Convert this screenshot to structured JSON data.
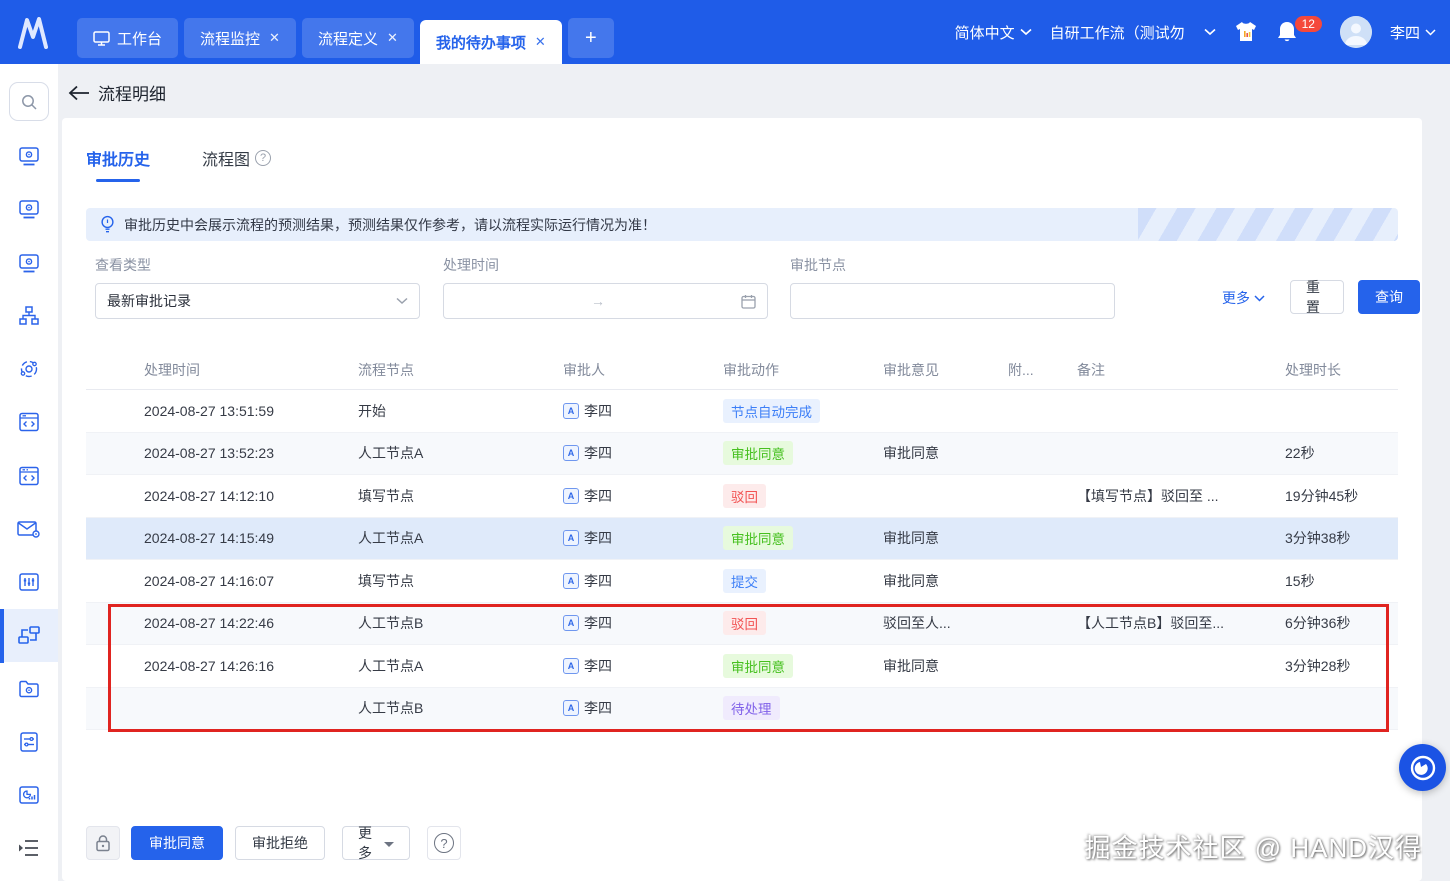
{
  "colors": {
    "navbar": "#1f5ce8",
    "accent": "#2563eb",
    "annotation_red": "#e02420",
    "tag_blue": "#3d7ff7",
    "tag_green": "#46c01f",
    "tag_red": "#f25353",
    "tag_purple": "#8162e9"
  },
  "navbar": {
    "tabs": [
      {
        "label": "工作台",
        "icon": "workbench-icon",
        "closable": false,
        "active": false
      },
      {
        "label": "流程监控",
        "closable": true,
        "active": false
      },
      {
        "label": "流程定义",
        "closable": true,
        "active": false
      },
      {
        "label": "我的待办事项",
        "closable": true,
        "active": true
      },
      {
        "label": "+",
        "plus": true
      }
    ],
    "language": "简体中文",
    "workspace": "自研工作流（测试勿",
    "notification_count": "12",
    "username": "李四"
  },
  "sidebar": {
    "icons": [
      "search-icon",
      "workbench-monitor-icon",
      "workbench-monitor-icon",
      "workbench-monitor-icon",
      "org-hierarchy-icon",
      "service-gear-icon",
      "code-window-icon",
      "api-window-icon",
      "mail-settings-icon",
      "filter-sliders-icon",
      "flow-nodes-icon",
      "folder-settings-icon",
      "form-settings-icon",
      "report-chart-icon",
      "collapse-menu-icon"
    ],
    "active_icon": "flow-nodes-icon"
  },
  "page": {
    "back_title": "流程明细"
  },
  "content_tabs": {
    "history": "审批历史",
    "diagram": "流程图"
  },
  "banner": {
    "text": "审批历史中会展示流程的预测结果，预测结果仅作参考，请以流程实际运行情况为准！"
  },
  "filters": {
    "view_type_label": "查看类型",
    "view_type_value": "最新审批记录",
    "time_label": "处理时间",
    "time_separator": "→",
    "node_label": "审批节点",
    "more_label": "更多",
    "reset_label": "重置",
    "search_label": "查询"
  },
  "table": {
    "headers": [
      "处理时间",
      "流程节点",
      "审批人",
      "审批动作",
      "审批意见",
      "附...",
      "备注",
      "处理时长"
    ],
    "rows": [
      {
        "time": "2024-08-27 13:51:59",
        "node": "开始",
        "approver": "李四",
        "action": {
          "text": "节点自动完成",
          "type": "blue"
        },
        "opinion": "",
        "attachment": "",
        "remark": "",
        "duration": ""
      },
      {
        "time": "2024-08-27 13:52:23",
        "node": "人工节点A",
        "approver": "李四",
        "action": {
          "text": "审批同意",
          "type": "green"
        },
        "opinion": "审批同意",
        "attachment": "",
        "remark": "",
        "duration": "22秒"
      },
      {
        "time": "2024-08-27 14:12:10",
        "node": "填写节点",
        "approver": "李四",
        "action": {
          "text": "驳回",
          "type": "red"
        },
        "opinion": "",
        "attachment": "",
        "remark": "【填写节点】驳回至 ...",
        "duration": "19分钟45秒"
      },
      {
        "time": "2024-08-27 14:15:49",
        "node": "人工节点A",
        "approver": "李四",
        "action": {
          "text": "审批同意",
          "type": "green"
        },
        "opinion": "审批同意",
        "attachment": "",
        "remark": "",
        "duration": "3分钟38秒",
        "highlight": true
      },
      {
        "time": "2024-08-27 14:16:07",
        "node": "填写节点",
        "approver": "李四",
        "action": {
          "text": "提交",
          "type": "blue"
        },
        "opinion": "审批同意",
        "attachment": "",
        "remark": "",
        "duration": "15秒"
      },
      {
        "time": "2024-08-27 14:22:46",
        "node": "人工节点B",
        "approver": "李四",
        "action": {
          "text": "驳回",
          "type": "red"
        },
        "opinion": "驳回至人...",
        "attachment": "",
        "remark": "【人工节点B】驳回至...",
        "duration": "6分钟36秒"
      },
      {
        "time": "2024-08-27 14:26:16",
        "node": "人工节点A",
        "approver": "李四",
        "action": {
          "text": "审批同意",
          "type": "green"
        },
        "opinion": "审批同意",
        "attachment": "",
        "remark": "",
        "duration": "3分钟28秒"
      },
      {
        "time": "",
        "node": "人工节点B",
        "approver": "李四",
        "action": {
          "text": "待处理",
          "type": "purple"
        },
        "opinion": "",
        "attachment": "",
        "remark": "",
        "duration": ""
      }
    ]
  },
  "footer": {
    "approve_label": "审批同意",
    "reject_label": "审批拒绝",
    "more_label": "更多",
    "lock_icon": "lock-icon",
    "help_icon": "help-icon"
  },
  "watermark": "掘金技术社区 @ HAND汉得"
}
